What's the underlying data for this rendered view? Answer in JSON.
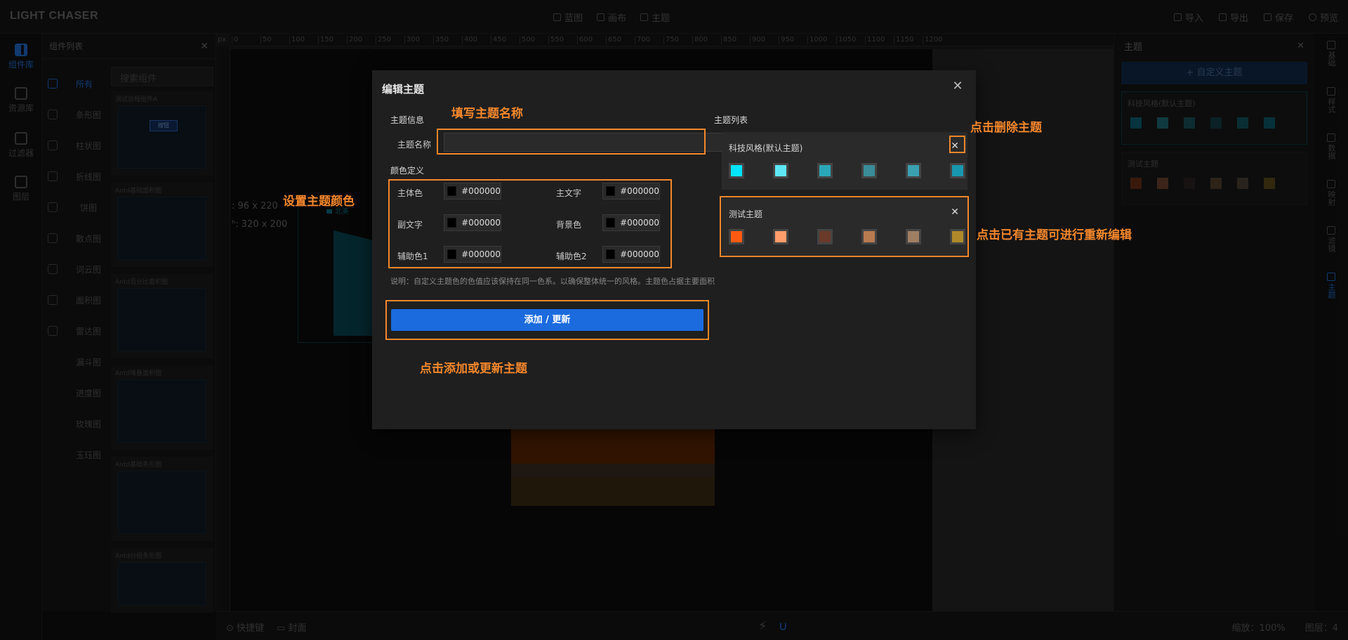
{
  "header": {
    "logo": "LIGHT CHASER",
    "nav": [
      {
        "label": "蓝图",
        "icon": "blueprint-icon"
      },
      {
        "label": "画布",
        "icon": "canvas-icon"
      },
      {
        "label": "主题",
        "icon": "theme-icon"
      }
    ],
    "actions": [
      {
        "label": "导入",
        "icon": "import-icon"
      },
      {
        "label": "导出",
        "icon": "export-icon"
      },
      {
        "label": "保存",
        "icon": "save-icon"
      },
      {
        "label": "预览",
        "icon": "preview-icon"
      }
    ]
  },
  "left_nav": {
    "items": [
      {
        "label": "组件库",
        "active": true
      },
      {
        "label": "资源库",
        "active": false
      },
      {
        "label": "过滤器",
        "active": false
      },
      {
        "label": "图层",
        "active": false
      }
    ]
  },
  "component_panel": {
    "title": "组件列表",
    "search_placeholder": "搜索组件",
    "categories": [
      "所有",
      "条形图",
      "柱状图",
      "折线图",
      "饼图",
      "散点图",
      "词云图",
      "面积图",
      "雷达图",
      "漏斗图",
      "进度图",
      "玫瑰图",
      "玉珏图"
    ],
    "thumbnails": [
      {
        "label": "测试远程组件A",
        "badge": "按钮"
      },
      {
        "label": "Antd基础面积图"
      },
      {
        "label": "Antd百分比面积图"
      },
      {
        "label": "Antd堆叠面积图"
      },
      {
        "label": "Antd基础条形图"
      },
      {
        "label": "Antd分组条形图"
      }
    ]
  },
  "ruler": {
    "unit": "px",
    "marks": [
      "0",
      "50",
      "100",
      "150",
      "200",
      "250",
      "300",
      "350",
      "400",
      "450",
      "500",
      "550",
      "600",
      "650",
      "700",
      "750",
      "800",
      "850",
      "900",
      "950",
      "1000",
      "1050",
      "1100",
      "1150",
      "1200"
    ]
  },
  "canvas": {
    "pos_text": "96 x 220",
    "size_text": "320 x 200",
    "legend_label": "北美"
  },
  "right_panel": {
    "title": "主题",
    "add_label": "+ 自定义主题",
    "themes": [
      {
        "name": "科技风格(默认主题)",
        "colors": [
          "#0b5f73",
          "#1c6a76",
          "#16505a",
          "#143c44",
          "#12545f",
          "#0b5a6a"
        ]
      },
      {
        "name": "测试主题",
        "colors": [
          "#6b2f14",
          "#6e4230",
          "#2a2422",
          "#55402f",
          "#4b4036",
          "#5a4a1a"
        ]
      }
    ]
  },
  "right_strip": {
    "items": [
      {
        "label": "基础",
        "active": false
      },
      {
        "label": "样式",
        "active": false
      },
      {
        "label": "数据",
        "active": false
      },
      {
        "label": "映射",
        "active": false
      },
      {
        "label": "滤镜",
        "active": false
      },
      {
        "label": "主题",
        "active": true
      }
    ]
  },
  "bottom": {
    "shortcut_label": "快捷键",
    "cover_label": "封面",
    "zoom_text": "缩放：100%",
    "layer_text": "图层：4"
  },
  "dialog": {
    "title": "编辑主题",
    "theme_info_label": "主题信息",
    "theme_name_label": "主题名称",
    "theme_name_value": "",
    "color_def_label": "颜色定义",
    "colors": [
      {
        "label": "主体色",
        "value": "#000000"
      },
      {
        "label": "主文字",
        "value": "#000000"
      },
      {
        "label": "副文字",
        "value": "#000000"
      },
      {
        "label": "背景色",
        "value": "#000000"
      },
      {
        "label": "辅助色1",
        "value": "#000000"
      },
      {
        "label": "辅助色2",
        "value": "#000000"
      }
    ],
    "note": "说明：自定义主题色的色值应该保持在同一色系。以确保整体统一的风格。主题色占据主要面积",
    "submit_label": "添加 / 更新",
    "list_label": "主题列表",
    "list": [
      {
        "name": "科技风格(默认主题)",
        "colors": [
          "#00e5ff",
          "#5ee6f5",
          "#2aa7b8",
          "#3a8c98",
          "#3aa0b0",
          "#1997b0"
        ]
      },
      {
        "name": "测试主题",
        "colors": [
          "#ff5a12",
          "#ff9c6a",
          "#6a3a2a",
          "#b87a50",
          "#a07e62",
          "#b08a2a"
        ]
      }
    ]
  },
  "annotations": {
    "fill_name": "填写主题名称",
    "set_color": "设置主题颜色",
    "add_update": "点击添加或更新主题",
    "delete_theme": "点击删除主题",
    "reedit": "点击已有主题可进行重新编辑"
  },
  "colors": {
    "accent": "#1b6bde",
    "annotation": "#f5872c",
    "dialog_bg": "#1f1f1f"
  }
}
